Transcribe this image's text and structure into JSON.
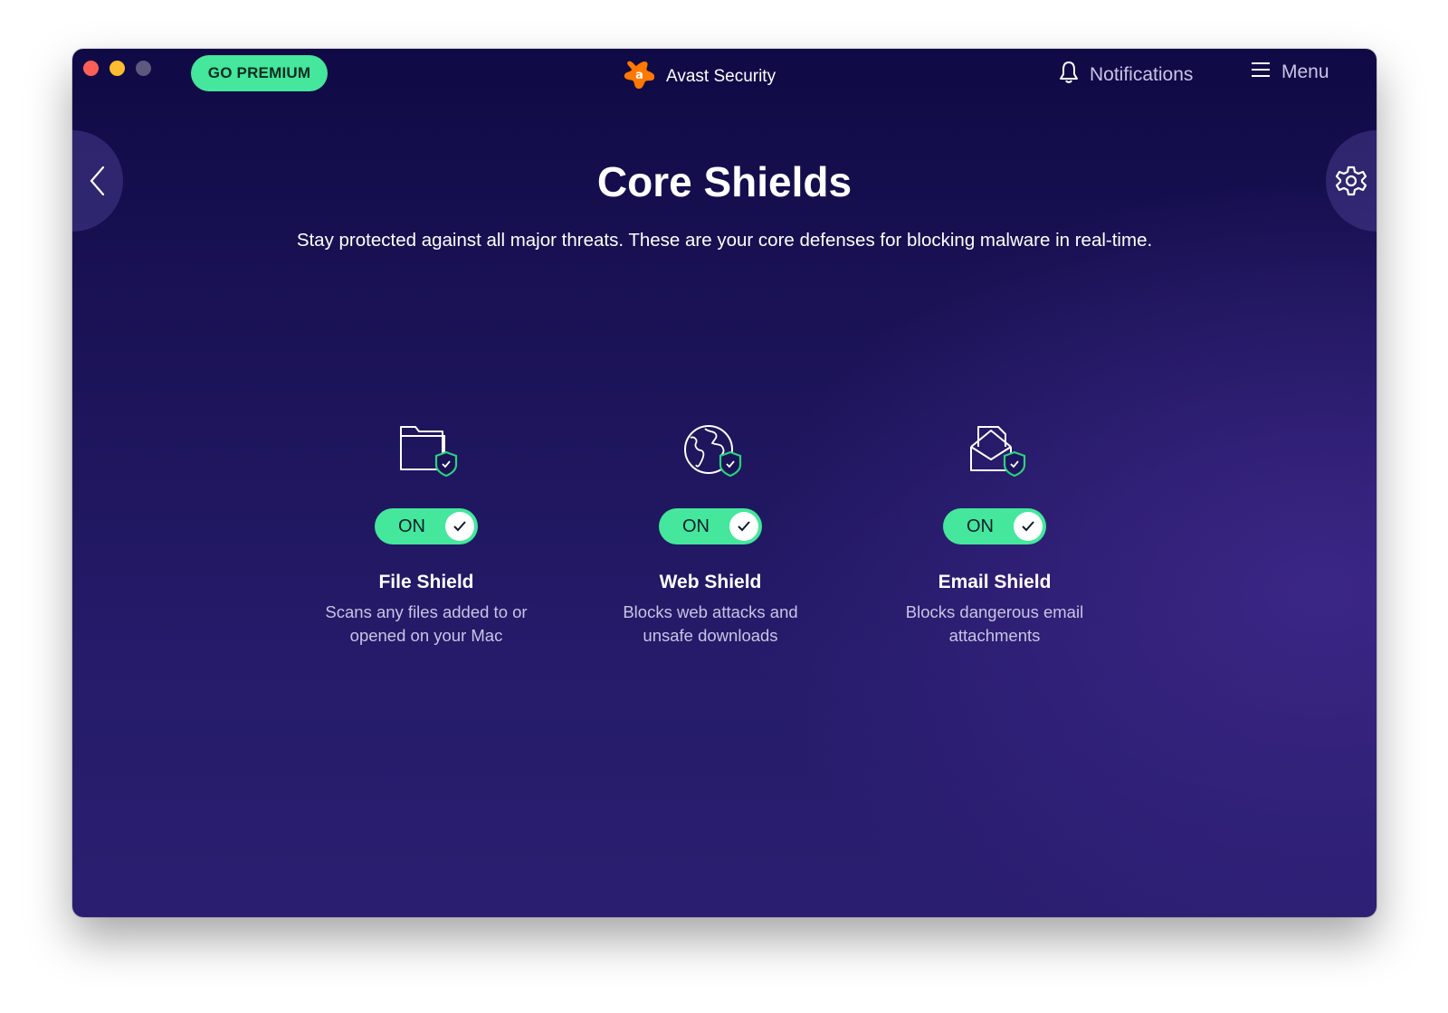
{
  "window": {
    "app_title": "Avast Security",
    "premium_label": "GO PREMIUM"
  },
  "topbar": {
    "notifications_label": "Notifications",
    "menu_label": "Menu"
  },
  "page": {
    "title": "Core Shields",
    "subtitle": "Stay protected against all major threats. These are your core defenses for blocking malware in real-time."
  },
  "shields": [
    {
      "name": "File Shield",
      "state": "ON",
      "icon": "folder-shield-icon",
      "desc_line1": "Scans any files added to or",
      "desc_line2": "opened on your Mac"
    },
    {
      "name": "Web Shield",
      "state": "ON",
      "icon": "globe-shield-icon",
      "desc_line1": "Blocks web attacks and",
      "desc_line2": "unsafe downloads"
    },
    {
      "name": "Email Shield",
      "state": "ON",
      "icon": "envelope-shield-icon",
      "desc_line1": "Blocks dangerous email",
      "desc_line2": "attachments"
    }
  ],
  "colors": {
    "accent_green": "#44e79b",
    "brand_orange": "#ff7800",
    "background_dark": "#0f0a45",
    "background_purple": "#2a1e70"
  }
}
